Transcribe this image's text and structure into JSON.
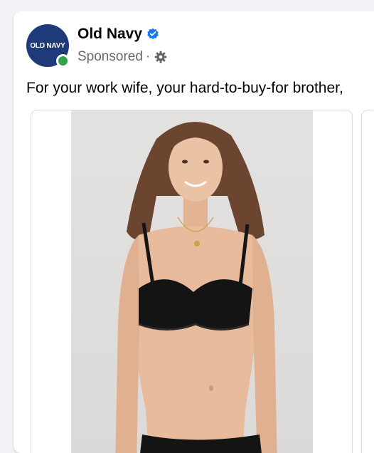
{
  "post": {
    "page_name": "Old Navy",
    "avatar_text": "OLD NAVY",
    "sponsored_label": "Sponsored",
    "separator": "·",
    "caption": "For your work wife, your hard-to-buy-for brother,"
  },
  "colors": {
    "brand": "#1f3a78",
    "verified": "#1877f2",
    "online": "#31a24c"
  },
  "icons": {
    "verified": "verified-badge-icon",
    "audience": "gear-icon"
  }
}
